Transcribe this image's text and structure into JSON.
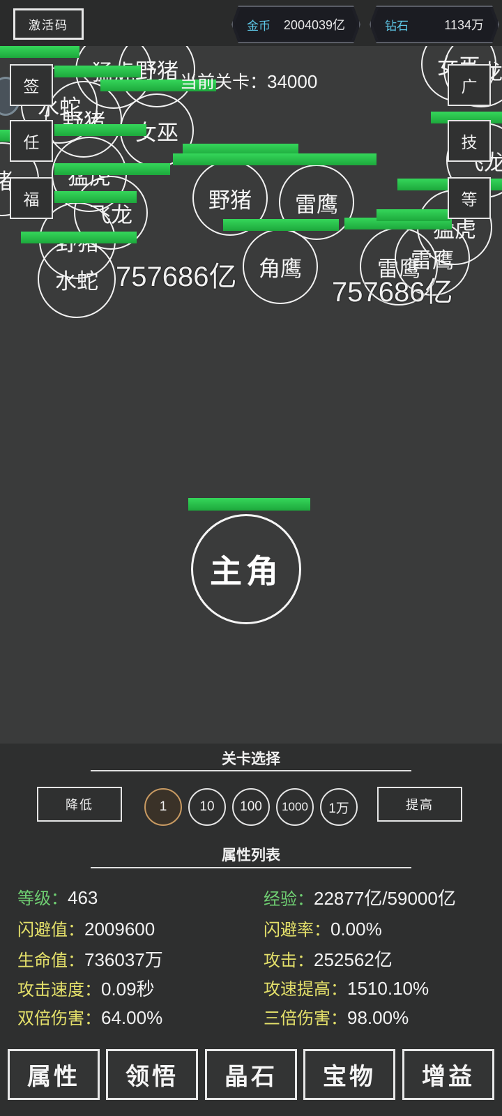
{
  "topbar": {
    "activate_label": "激活码",
    "coin_label": "金币",
    "coin_value": "2004039亿",
    "diamond_label": "钻石",
    "diamond_value": "1134万"
  },
  "battle": {
    "level_label": "当前关卡：",
    "level_value": "34000",
    "damage_texts": [
      "757686亿",
      "757686亿"
    ],
    "enemies": [
      "猛虎",
      "野猪",
      "水蛇",
      "野猪",
      "女巫",
      "猛虎",
      "飞龙",
      "野猪",
      "水蛇",
      "野猪",
      "雷鹰",
      "角鹰",
      "雷鹰",
      "雷鹰",
      "猛虎",
      "飞龙",
      "女巫",
      "飞龙",
      "猪"
    ],
    "hero_label": "主角"
  },
  "side_left": [
    "签",
    "任",
    "福"
  ],
  "side_right": [
    "广",
    "技",
    "等"
  ],
  "level_select": {
    "title": "关卡选择",
    "decrease": "降低",
    "increase": "提高",
    "steps": [
      "1",
      "10",
      "100",
      "1000",
      "1万"
    ],
    "selected": "1"
  },
  "attributes": {
    "title": "属性列表",
    "rows": [
      {
        "label": "等级：",
        "value": "463"
      },
      {
        "label": "经验：",
        "value": "22877亿/59000亿"
      },
      {
        "label": "闪避值：",
        "value": "2009600"
      },
      {
        "label": "闪避率：",
        "value": "0.00%"
      },
      {
        "label": "生命值：",
        "value": "736037万"
      },
      {
        "label": "攻击：",
        "value": "252562亿"
      },
      {
        "label": "攻击速度：",
        "value": "0.09秒"
      },
      {
        "label": "攻速提高：",
        "value": "1510.10%"
      },
      {
        "label": "双倍伤害：",
        "value": "64.00%"
      },
      {
        "label": "三倍伤害：",
        "value": "98.00%"
      }
    ]
  },
  "tabs": [
    "属性",
    "领悟",
    "晶石",
    "宝物",
    "增益"
  ],
  "colors": {
    "hp_green": "#2bc24e",
    "label_yellow": "#e4e06a",
    "label_green": "#6fcf72",
    "currency_cyan": "#5ec8e8"
  }
}
